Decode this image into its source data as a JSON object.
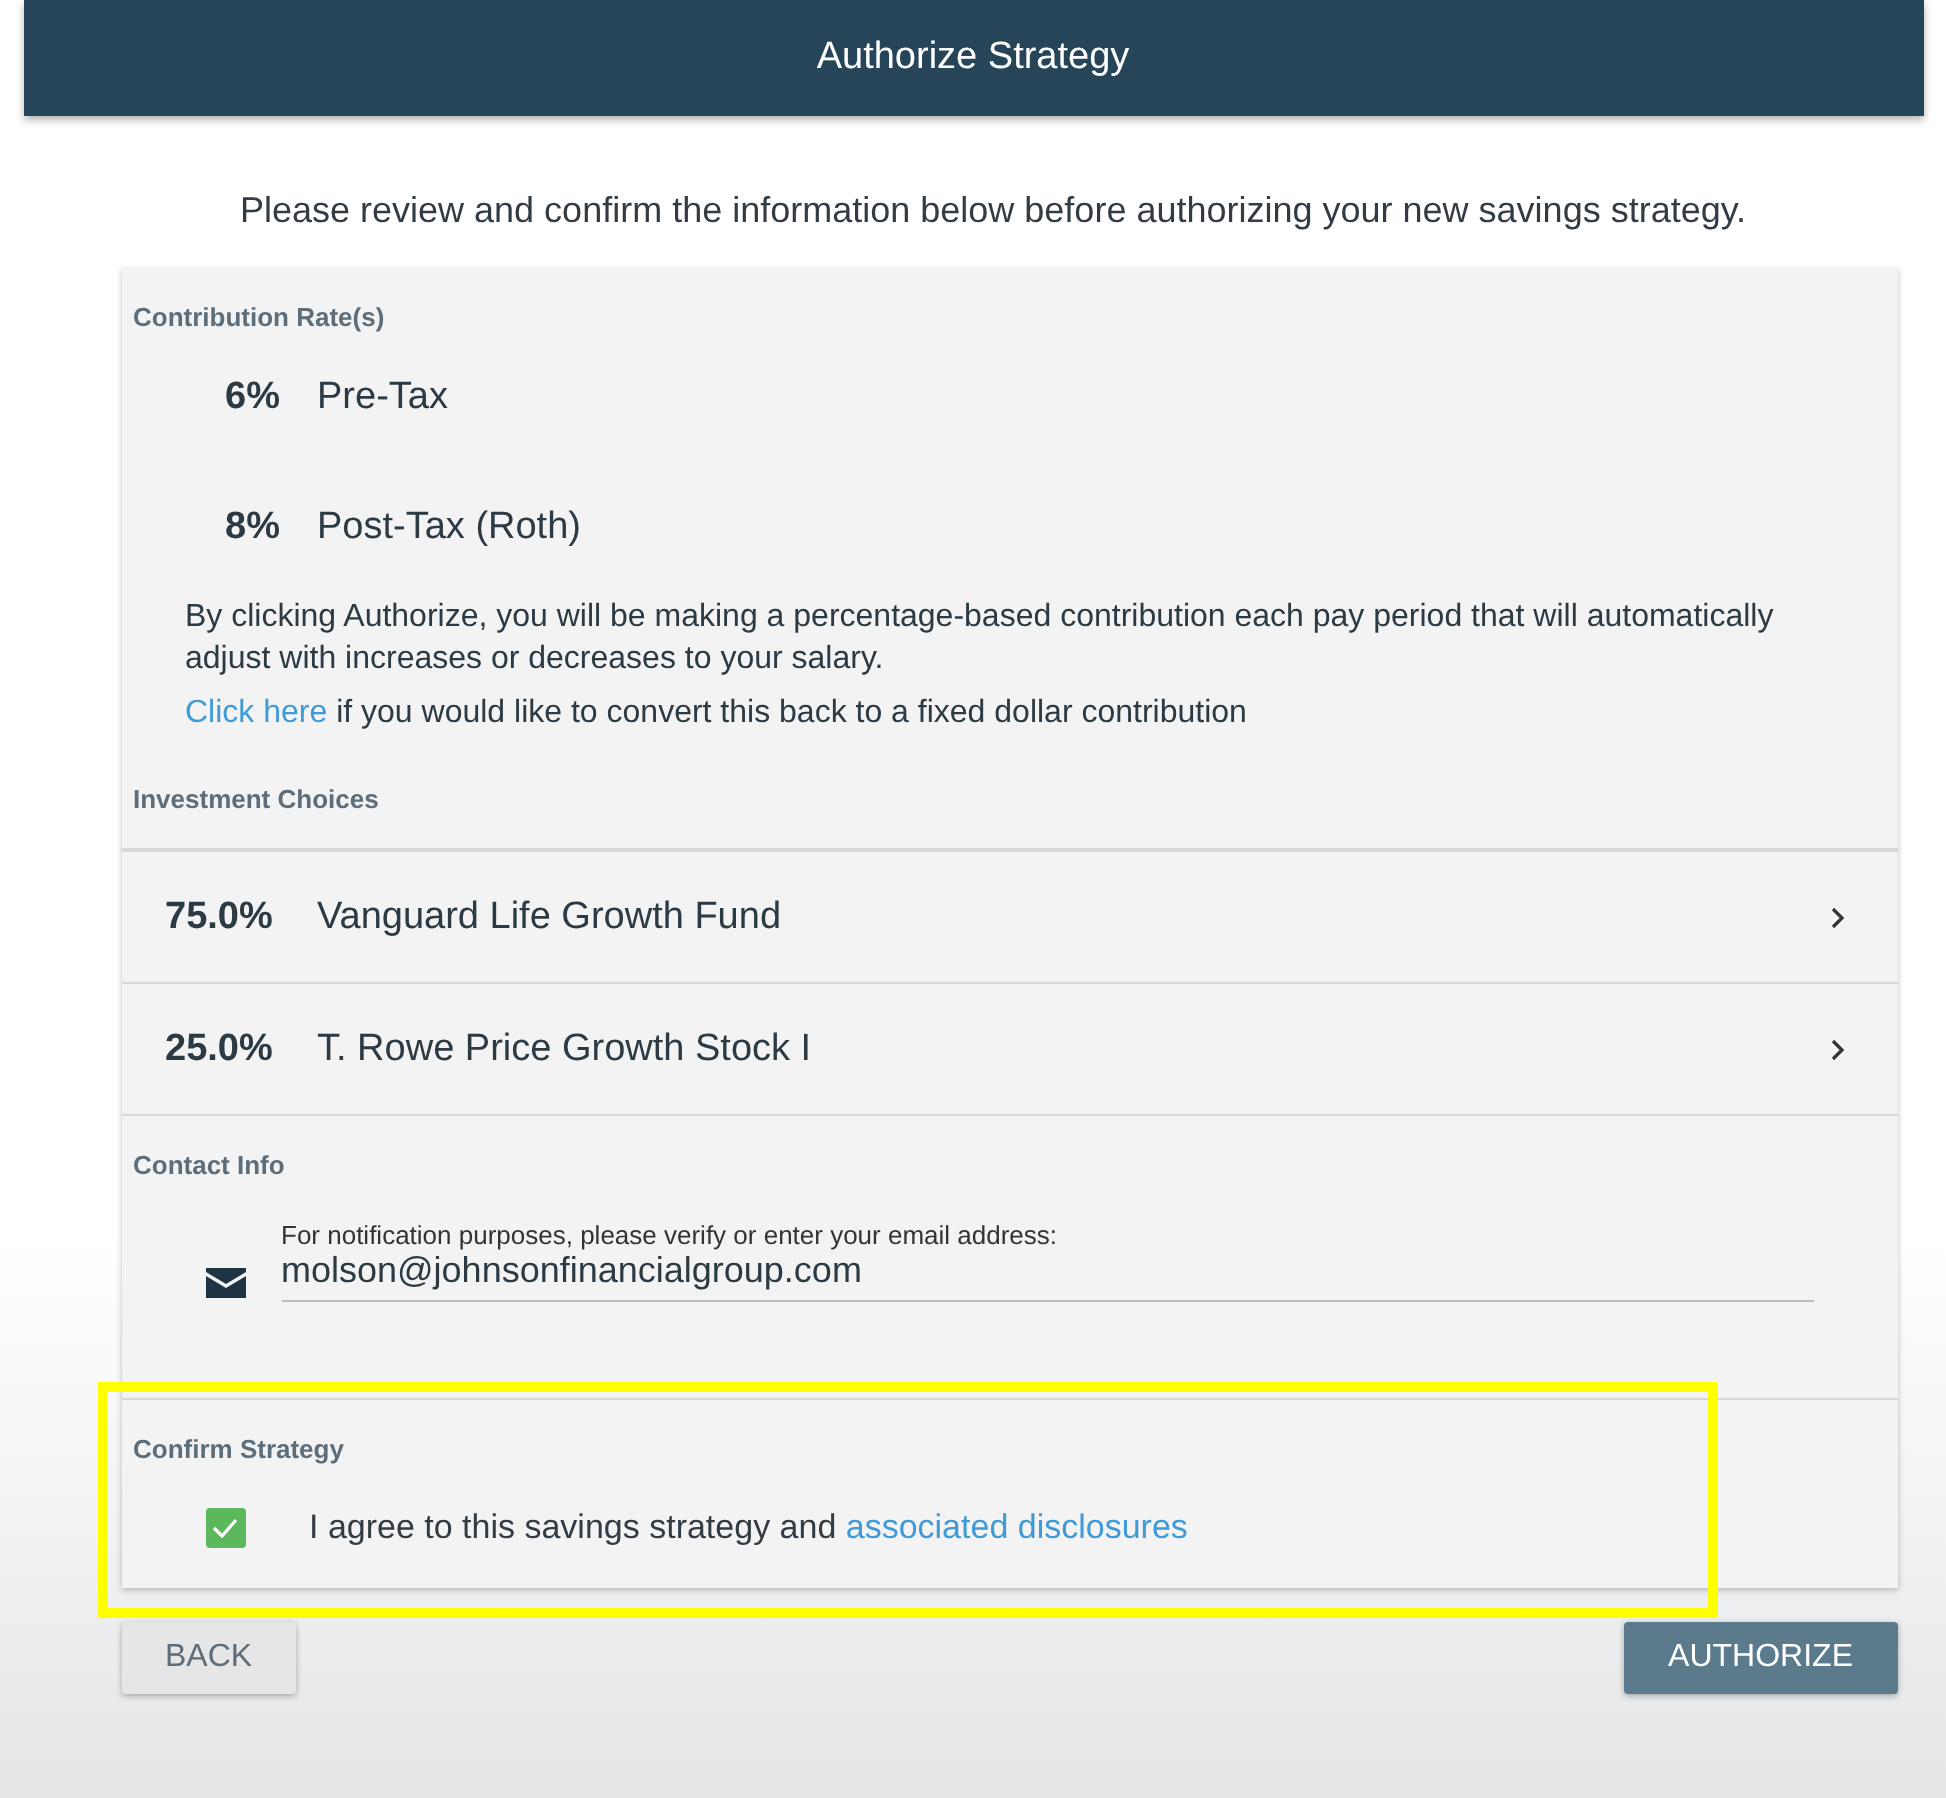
{
  "header": {
    "title": "Authorize Strategy"
  },
  "intro": "Please review and confirm the information below before authorizing your new savings strategy.",
  "contribution": {
    "heading": "Contribution Rate(s)",
    "rates": [
      {
        "percent": "6%",
        "label": "Pre-Tax"
      },
      {
        "percent": "8%",
        "label": "Post-Tax (Roth)"
      }
    ],
    "notice": "By clicking Authorize, you will be making a percentage-based contribution each pay period that will automatically adjust with increases or decreases to your salary.",
    "link": "Click here",
    "link_rest": " if you would like to convert this back to a fixed dollar contribution"
  },
  "investments": {
    "heading": "Investment Choices",
    "funds": [
      {
        "percent": "75.0%",
        "name": "Vanguard Life Growth Fund"
      },
      {
        "percent": "25.0%",
        "name": "T. Rowe Price Growth Stock I"
      }
    ]
  },
  "contact": {
    "heading": "Contact Info",
    "field_label": "For notification purposes, please verify or enter your email address:",
    "email": "molson@johnsonfinancialgroup.com"
  },
  "confirm": {
    "heading": "Confirm Strategy",
    "checked": true,
    "text": "I agree to this savings strategy and ",
    "link": "associated disclosures",
    "highlighted": true
  },
  "buttons": {
    "back": "BACK",
    "authorize": "AUTHORIZE"
  }
}
